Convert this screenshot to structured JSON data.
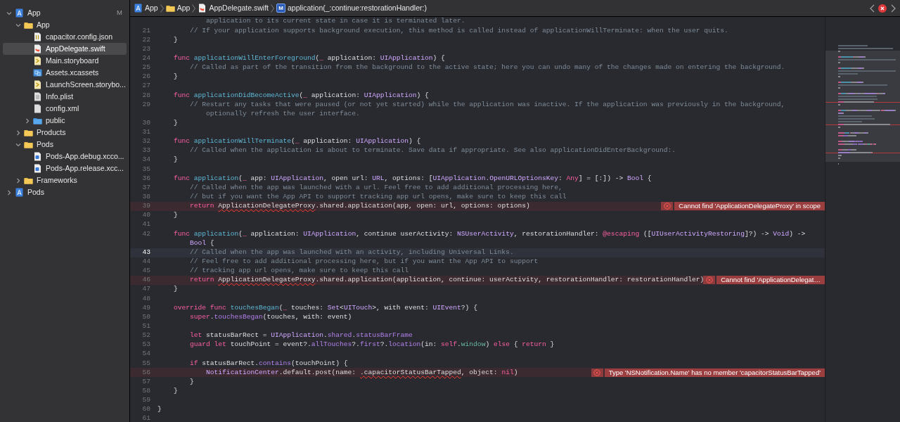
{
  "navigator": {
    "items": [
      {
        "label": "App",
        "kind": "project",
        "badge": "M",
        "expanded": true,
        "selected": false,
        "children": [
          {
            "label": "App",
            "kind": "folder",
            "expanded": true,
            "selected": false,
            "children": [
              {
                "label": "capacitor.config.json",
                "kind": "json",
                "selected": false
              },
              {
                "label": "AppDelegate.swift",
                "kind": "swift",
                "selected": true
              },
              {
                "label": "Main.storyboard",
                "kind": "storyboard",
                "selected": false
              },
              {
                "label": "Assets.xcassets",
                "kind": "assets",
                "selected": false
              },
              {
                "label": "LaunchScreen.storybo...",
                "kind": "storyboard",
                "selected": false
              },
              {
                "label": "Info.plist",
                "kind": "plist",
                "selected": false
              },
              {
                "label": "config.xml",
                "kind": "file",
                "selected": false
              },
              {
                "label": "public",
                "kind": "bluefolder",
                "expanded": false,
                "selected": false
              }
            ]
          },
          {
            "label": "Products",
            "kind": "folder",
            "expanded": false,
            "selected": false
          },
          {
            "label": "Pods",
            "kind": "folder",
            "expanded": true,
            "selected": false,
            "children": [
              {
                "label": "Pods-App.debug.xcco...",
                "kind": "config",
                "selected": false
              },
              {
                "label": "Pods-App.release.xcc...",
                "kind": "config",
                "selected": false
              }
            ]
          },
          {
            "label": "Frameworks",
            "kind": "folder",
            "expanded": false,
            "selected": false
          }
        ]
      },
      {
        "label": "Pods",
        "kind": "project",
        "expanded": false,
        "selected": false
      }
    ]
  },
  "breadcrumb": [
    {
      "label": "App",
      "kind": "project"
    },
    {
      "label": "App",
      "kind": "folder"
    },
    {
      "label": "AppDelegate.swift",
      "kind": "swift"
    },
    {
      "label": "application(_:continue:restorationHandler:)",
      "kind": "method",
      "glyph": "M"
    }
  ],
  "editor": {
    "rows": [
      {
        "kind": "plain",
        "segs": [
          {
            "kind": "comment",
            "text": "            application to its current state in case it is terminated later."
          }
        ]
      },
      {
        "number": "21",
        "kind": "plain",
        "segs": [
          {
            "kind": "comment",
            "text": "        // If your application supports background execution, this method is called instead of applicationWillTerminate: when the user quits."
          }
        ]
      },
      {
        "number": "22",
        "kind": "plain",
        "segs": [
          {
            "kind": "plain",
            "text": "    }"
          }
        ]
      },
      {
        "number": "23",
        "kind": "plain",
        "segs": []
      },
      {
        "number": "24",
        "kind": "plain",
        "segs": [
          {
            "kind": "keyword",
            "text": "    func"
          },
          {
            "kind": "decl",
            "text": " applicationWillEnterForeground"
          },
          {
            "kind": "plain",
            "text": "("
          },
          {
            "kind": "keyword",
            "text": "_"
          },
          {
            "kind": "plain",
            "text": " application: "
          },
          {
            "kind": "type",
            "text": "UIApplication"
          },
          {
            "kind": "plain",
            "text": ") {"
          }
        ]
      },
      {
        "number": "25",
        "kind": "plain",
        "segs": [
          {
            "kind": "comment",
            "text": "        // Called as part of the transition from the background to the active state; here you can undo many of the changes made on entering the background."
          }
        ]
      },
      {
        "number": "26",
        "kind": "plain",
        "segs": [
          {
            "kind": "plain",
            "text": "    }"
          }
        ]
      },
      {
        "number": "27",
        "kind": "plain",
        "segs": []
      },
      {
        "number": "28",
        "kind": "plain",
        "segs": [
          {
            "kind": "keyword",
            "text": "    func"
          },
          {
            "kind": "decl",
            "text": " applicationDidBecomeActive"
          },
          {
            "kind": "plain",
            "text": "("
          },
          {
            "kind": "keyword",
            "text": "_"
          },
          {
            "kind": "plain",
            "text": " application: "
          },
          {
            "kind": "type",
            "text": "UIApplication"
          },
          {
            "kind": "plain",
            "text": ") {"
          }
        ]
      },
      {
        "number": "29",
        "kind": "plain",
        "segs": [
          {
            "kind": "comment",
            "text": "        // Restart any tasks that were paused (or not yet started) while the application was inactive. If the application was previously in the background,"
          }
        ]
      },
      {
        "kind": "plain",
        "segs": [
          {
            "kind": "comment",
            "text": "            optionally refresh the user interface."
          }
        ]
      },
      {
        "number": "30",
        "kind": "plain",
        "segs": [
          {
            "kind": "plain",
            "text": "    }"
          }
        ]
      },
      {
        "number": "31",
        "kind": "plain",
        "segs": []
      },
      {
        "number": "32",
        "kind": "plain",
        "segs": [
          {
            "kind": "keyword",
            "text": "    func"
          },
          {
            "kind": "decl",
            "text": " applicationWillTerminate"
          },
          {
            "kind": "plain",
            "text": "("
          },
          {
            "kind": "keyword",
            "text": "_"
          },
          {
            "kind": "plain",
            "text": " application: "
          },
          {
            "kind": "type",
            "text": "UIApplication"
          },
          {
            "kind": "plain",
            "text": ") {"
          }
        ]
      },
      {
        "number": "33",
        "kind": "plain",
        "segs": [
          {
            "kind": "comment",
            "text": "        // Called when the application is about to terminate. Save data if appropriate. See also applicationDidEnterBackground:."
          }
        ]
      },
      {
        "number": "34",
        "kind": "plain",
        "segs": [
          {
            "kind": "plain",
            "text": "    }"
          }
        ]
      },
      {
        "number": "35",
        "kind": "plain",
        "segs": []
      },
      {
        "number": "36",
        "kind": "plain",
        "segs": [
          {
            "kind": "keyword",
            "text": "    func"
          },
          {
            "kind": "decl",
            "text": " application"
          },
          {
            "kind": "plain",
            "text": "("
          },
          {
            "kind": "keyword",
            "text": "_"
          },
          {
            "kind": "plain",
            "text": " app: "
          },
          {
            "kind": "type",
            "text": "UIApplication"
          },
          {
            "kind": "plain",
            "text": ", open url: "
          },
          {
            "kind": "type",
            "text": "URL"
          },
          {
            "kind": "plain",
            "text": ", options: ["
          },
          {
            "kind": "type",
            "text": "UIApplication.OpenURLOptionsKey"
          },
          {
            "kind": "plain",
            "text": ": "
          },
          {
            "kind": "keyword",
            "text": "Any"
          },
          {
            "kind": "plain",
            "text": "] = [:]) -> "
          },
          {
            "kind": "type",
            "text": "Bool"
          },
          {
            "kind": "plain",
            "text": " {"
          }
        ]
      },
      {
        "number": "37",
        "kind": "plain",
        "segs": [
          {
            "kind": "comment",
            "text": "        // Called when the app was launched with a url. Feel free to add additional processing here,"
          }
        ]
      },
      {
        "number": "38",
        "kind": "plain",
        "segs": [
          {
            "kind": "comment",
            "text": "        // but if you want the App API to support tracking app url opens, make sure to keep this call"
          }
        ]
      },
      {
        "number": "39",
        "kind": "error",
        "message": "Cannot find 'ApplicationDelegateProxy' in scope",
        "segs": [
          {
            "kind": "keyword",
            "text": "        return "
          },
          {
            "kind": "error",
            "text": "ApplicationDelegateProxy"
          },
          {
            "kind": "plain",
            "text": ".shared.application(app, open: url, options: options)"
          }
        ]
      },
      {
        "number": "40",
        "kind": "plain",
        "segs": [
          {
            "kind": "plain",
            "text": "    }"
          }
        ]
      },
      {
        "number": "41",
        "kind": "plain",
        "segs": []
      },
      {
        "number": "42",
        "kind": "plain",
        "segs": [
          {
            "kind": "keyword",
            "text": "    func"
          },
          {
            "kind": "decl",
            "text": " application"
          },
          {
            "kind": "plain",
            "text": "("
          },
          {
            "kind": "keyword",
            "text": "_"
          },
          {
            "kind": "plain",
            "text": " application: "
          },
          {
            "kind": "type",
            "text": "UIApplication"
          },
          {
            "kind": "plain",
            "text": ", continue userActivity: "
          },
          {
            "kind": "type",
            "text": "NSUserActivity"
          },
          {
            "kind": "plain",
            "text": ", restorationHandler: "
          },
          {
            "kind": "keyword",
            "text": "@escaping"
          },
          {
            "kind": "plain",
            "text": " (["
          },
          {
            "kind": "type",
            "text": "UIUserActivityRestoring"
          },
          {
            "kind": "plain",
            "text": "]?) -> "
          },
          {
            "kind": "type",
            "text": "Void"
          },
          {
            "kind": "plain",
            "text": ") ->"
          }
        ]
      },
      {
        "kind": "plain",
        "segs": [
          {
            "kind": "type",
            "text": "        Bool"
          },
          {
            "kind": "plain",
            "text": " {"
          }
        ]
      },
      {
        "number": "43",
        "kind": "current",
        "segs": [
          {
            "kind": "comment",
            "text": "        // Called when the app was launched with an activity, including Universal Links."
          }
        ]
      },
      {
        "number": "44",
        "kind": "plain",
        "segs": [
          {
            "kind": "comment",
            "text": "        // Feel free to add additional processing here, but if you want the App API to support"
          }
        ]
      },
      {
        "number": "45",
        "kind": "plain",
        "segs": [
          {
            "kind": "comment",
            "text": "        // tracking app url opens, make sure to keep this call"
          }
        ]
      },
      {
        "number": "46",
        "kind": "error",
        "message": "Cannot find 'ApplicationDelegat…",
        "segs": [
          {
            "kind": "keyword",
            "text": "        return "
          },
          {
            "kind": "error",
            "text": "ApplicationDelegateProxy"
          },
          {
            "kind": "plain",
            "text": ".shared.application(application, continue: userActivity, restorationHandler: restorationHandler)"
          }
        ]
      },
      {
        "number": "47",
        "kind": "plain",
        "segs": [
          {
            "kind": "plain",
            "text": "    }"
          }
        ]
      },
      {
        "number": "48",
        "kind": "plain",
        "segs": []
      },
      {
        "number": "49",
        "kind": "plain",
        "segs": [
          {
            "kind": "keyword",
            "text": "    override func"
          },
          {
            "kind": "decl",
            "text": " touchesBegan"
          },
          {
            "kind": "plain",
            "text": "("
          },
          {
            "kind": "keyword",
            "text": "_"
          },
          {
            "kind": "plain",
            "text": " touches: "
          },
          {
            "kind": "type",
            "text": "Set"
          },
          {
            "kind": "plain",
            "text": "<"
          },
          {
            "kind": "type",
            "text": "UITouch"
          },
          {
            "kind": "plain",
            "text": ">, with event: "
          },
          {
            "kind": "type",
            "text": "UIEvent"
          },
          {
            "kind": "plain",
            "text": "?) {"
          }
        ]
      },
      {
        "number": "50",
        "kind": "plain",
        "segs": [
          {
            "kind": "keyword",
            "text": "        super"
          },
          {
            "kind": "plain",
            "text": "."
          },
          {
            "kind": "call",
            "text": "touchesBegan"
          },
          {
            "kind": "plain",
            "text": "(touches, with: event)"
          }
        ]
      },
      {
        "number": "51",
        "kind": "plain",
        "segs": []
      },
      {
        "number": "52",
        "kind": "plain",
        "segs": [
          {
            "kind": "keyword",
            "text": "        let"
          },
          {
            "kind": "plain",
            "text": " statusBarRect = "
          },
          {
            "kind": "type",
            "text": "UIApplication"
          },
          {
            "kind": "plain",
            "text": "."
          },
          {
            "kind": "call",
            "text": "shared"
          },
          {
            "kind": "plain",
            "text": "."
          },
          {
            "kind": "call",
            "text": "statusBarFrame"
          }
        ]
      },
      {
        "number": "53",
        "kind": "plain",
        "segs": [
          {
            "kind": "keyword",
            "text": "        guard let"
          },
          {
            "kind": "plain",
            "text": " touchPoint = event?."
          },
          {
            "kind": "call",
            "text": "allTouches"
          },
          {
            "kind": "plain",
            "text": "?."
          },
          {
            "kind": "call",
            "text": "first"
          },
          {
            "kind": "plain",
            "text": "?."
          },
          {
            "kind": "call",
            "text": "location"
          },
          {
            "kind": "plain",
            "text": "(in: "
          },
          {
            "kind": "keyword",
            "text": "self"
          },
          {
            "kind": "plain",
            "text": "."
          },
          {
            "kind": "property",
            "text": "window"
          },
          {
            "kind": "plain",
            "text": ") "
          },
          {
            "kind": "keyword",
            "text": "else"
          },
          {
            "kind": "plain",
            "text": " { "
          },
          {
            "kind": "keyword",
            "text": "return"
          },
          {
            "kind": "plain",
            "text": " }"
          }
        ]
      },
      {
        "number": "54",
        "kind": "plain",
        "segs": []
      },
      {
        "number": "55",
        "kind": "plain",
        "segs": [
          {
            "kind": "keyword",
            "text": "        if"
          },
          {
            "kind": "plain",
            "text": " statusBarRect."
          },
          {
            "kind": "call",
            "text": "contains"
          },
          {
            "kind": "plain",
            "text": "(touchPoint) {"
          }
        ]
      },
      {
        "number": "56",
        "kind": "error",
        "message": "Type 'NSNotification.Name' has no member 'capacitorStatusBarTapped'",
        "segs": [
          {
            "kind": "type",
            "text": "            NotificationCenter"
          },
          {
            "kind": "plain",
            "text": ".default.post(name: "
          },
          {
            "kind": "error",
            "text": ".capacitorStatusBarTapped"
          },
          {
            "kind": "plain",
            "text": ", object: "
          },
          {
            "kind": "keyword",
            "text": "nil"
          },
          {
            "kind": "plain",
            "text": ")"
          }
        ]
      },
      {
        "number": "57",
        "kind": "plain",
        "segs": [
          {
            "kind": "plain",
            "text": "        }"
          }
        ]
      },
      {
        "number": "58",
        "kind": "plain",
        "segs": [
          {
            "kind": "plain",
            "text": "    }"
          }
        ]
      },
      {
        "number": "59",
        "kind": "plain",
        "segs": []
      },
      {
        "number": "60",
        "kind": "plain",
        "segs": [
          {
            "kind": "plain",
            "text": "}"
          }
        ]
      },
      {
        "number": "61",
        "kind": "plain",
        "segs": []
      }
    ]
  }
}
